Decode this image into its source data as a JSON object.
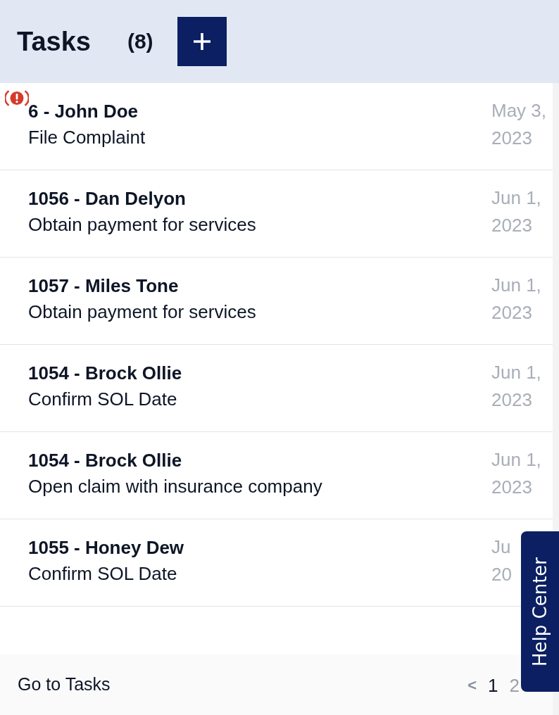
{
  "header": {
    "title": "Tasks",
    "count": "(8)"
  },
  "tasks": [
    {
      "title": "6 - John Doe",
      "description": "File Complaint",
      "date": [
        "May 3,",
        "2023"
      ],
      "alert": true
    },
    {
      "title": "1056 - Dan Delyon",
      "description": "Obtain payment for services",
      "date": [
        "Jun 1,",
        "2023"
      ],
      "alert": false
    },
    {
      "title": "1057 - Miles Tone",
      "description": "Obtain payment for services",
      "date": [
        "Jun 1,",
        "2023"
      ],
      "alert": false
    },
    {
      "title": "1054 - Brock Ollie",
      "description": "Confirm SOL Date",
      "date": [
        "Jun 1,",
        "2023"
      ],
      "alert": false
    },
    {
      "title": "1054 - Brock Ollie",
      "description": "Open claim with insurance company",
      "date": [
        "Jun 1,",
        "2023"
      ],
      "alert": false
    },
    {
      "title": "1055 - Honey Dew",
      "description": "Confirm SOL Date",
      "date": [
        "Ju",
        "20"
      ],
      "alert": false
    }
  ],
  "help_center": {
    "label": "Help Center"
  },
  "footer": {
    "link": "Go to Tasks",
    "pagination": {
      "previous": "<",
      "pages": [
        {
          "label": "1",
          "selected": true
        },
        {
          "label": "2",
          "selected": false
        }
      ]
    }
  }
}
